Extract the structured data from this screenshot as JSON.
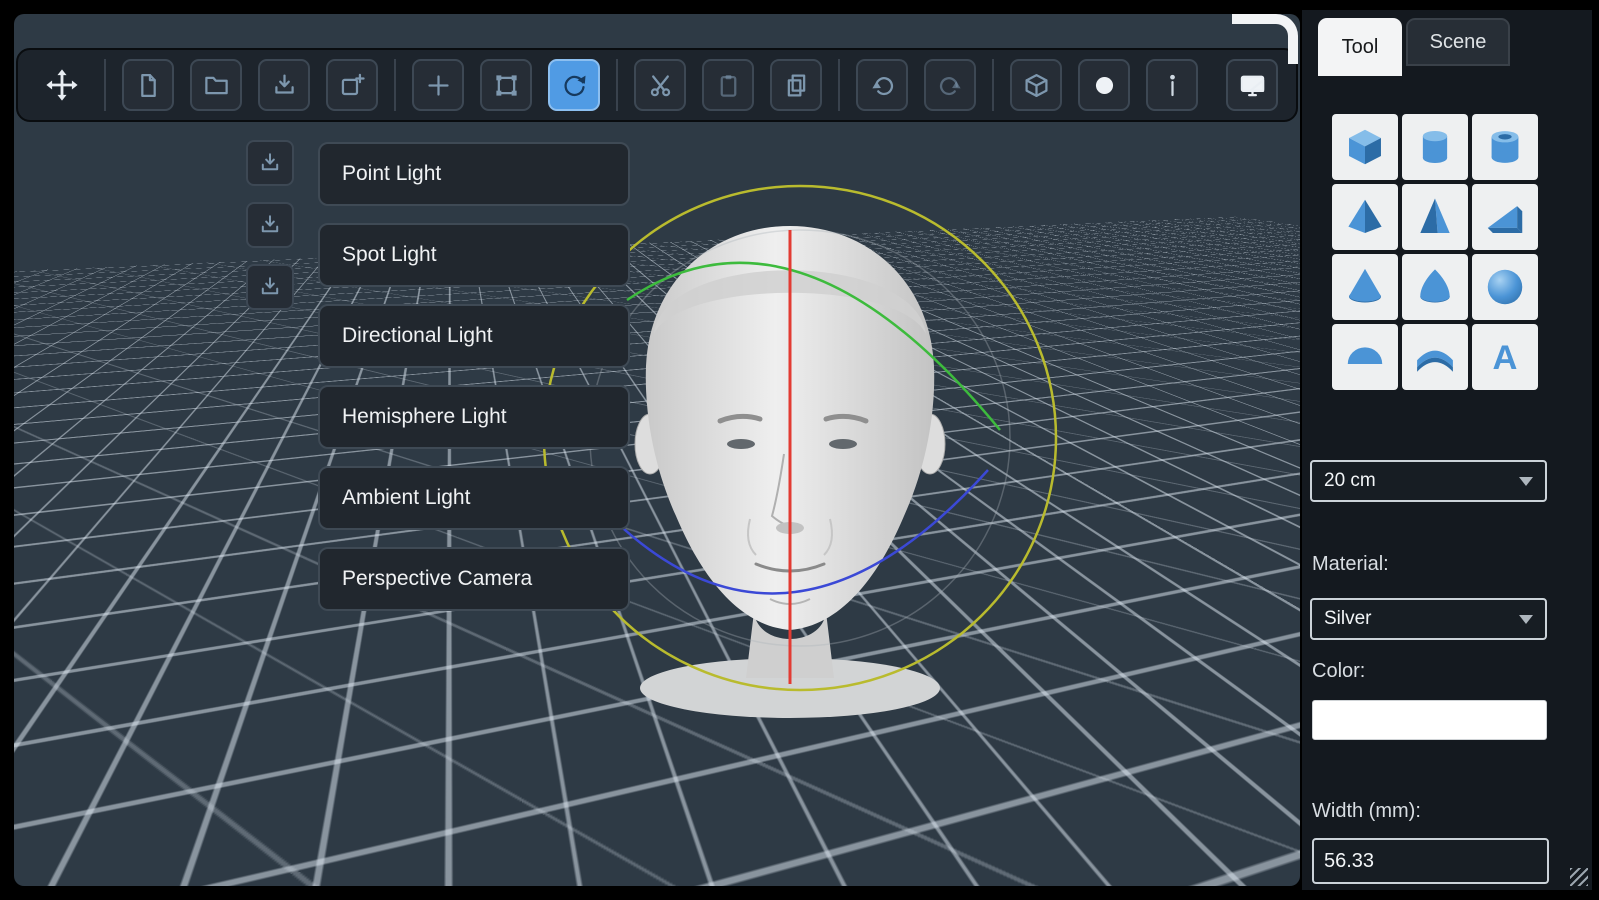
{
  "colors": {
    "canvas_bg": "#2e3a45",
    "panel_bg": "#14191f",
    "toolbar_bg": "#1d242c",
    "shape_blue": "#4b94d6",
    "active_button": "#509be4",
    "gizmo": {
      "ring": "#b9bb2e",
      "x_axis": "#e23b33",
      "y_axis": "#3dbb3d",
      "z_axis": "#3b49d6"
    }
  },
  "toolbar": {
    "active_tool": "rotate",
    "buttons": [
      {
        "name": "move",
        "icon": "move-icon"
      },
      {
        "name": "new-file",
        "icon": "new-file-icon"
      },
      {
        "name": "open",
        "icon": "folder-icon"
      },
      {
        "name": "import",
        "icon": "download-icon"
      },
      {
        "name": "import-add",
        "icon": "box-plus-icon"
      },
      {
        "name": "translate",
        "icon": "crosshair-icon"
      },
      {
        "name": "scale",
        "icon": "bounding-box-icon"
      },
      {
        "name": "rotate",
        "icon": "rotate-icon"
      },
      {
        "name": "cut",
        "icon": "scissors-icon"
      },
      {
        "name": "copy",
        "icon": "clipboard-icon"
      },
      {
        "name": "paste",
        "icon": "duplicate-icon"
      },
      {
        "name": "undo",
        "icon": "undo-arrow-icon"
      },
      {
        "name": "redo",
        "icon": "redo-arrow-icon"
      },
      {
        "name": "solid",
        "icon": "cube-outline-icon"
      },
      {
        "name": "record",
        "icon": "white-circle-icon"
      },
      {
        "name": "info",
        "icon": "info-icon"
      },
      {
        "name": "display",
        "icon": "monitor-icon"
      }
    ]
  },
  "left_import_buttons": {
    "count": 3,
    "icon": "download-icon"
  },
  "light_menu": {
    "items": [
      "Point Light",
      "Spot Light",
      "Directional Light",
      "Hemisphere Light",
      "Ambient Light",
      "Perspective Camera"
    ]
  },
  "panel": {
    "tabs": [
      {
        "label": "Tool"
      },
      {
        "label": "Scene"
      }
    ],
    "active_tab": "Tool",
    "shapes": [
      "cube",
      "cylinder",
      "tube",
      "pyramid",
      "tetrahedron",
      "wedge",
      "cone",
      "paraboloid",
      "sphere",
      "hemisphere",
      "curved-sheet",
      "text"
    ],
    "text_tool_glyph": "A",
    "size_select": {
      "value": "20 cm"
    },
    "material": {
      "label": "Material:",
      "value": "Silver"
    },
    "color": {
      "label": "Color:",
      "value": "#ffffff"
    },
    "width": {
      "label": "Width (mm):",
      "value": "56.33"
    }
  }
}
